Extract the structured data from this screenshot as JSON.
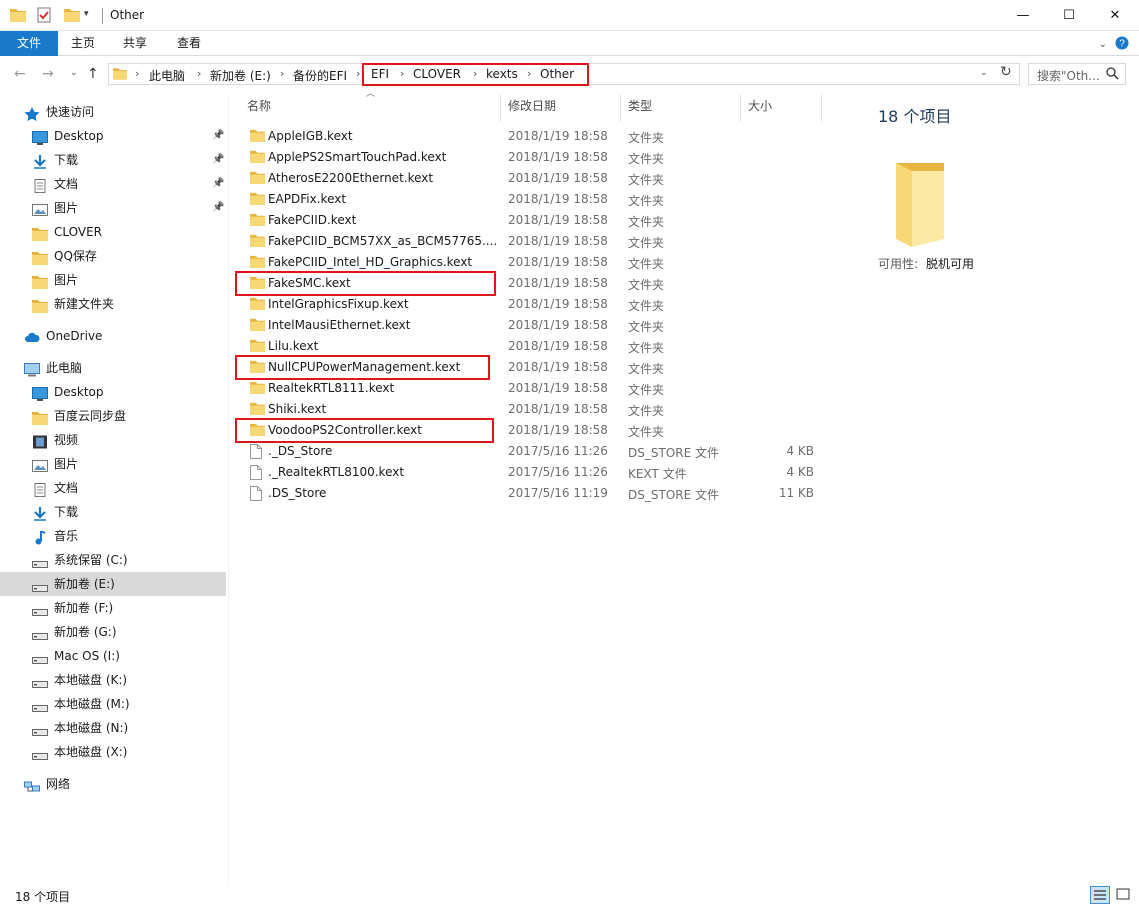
{
  "window": {
    "title": "Other",
    "controls": {
      "minimize": "—",
      "maximize": "☐",
      "close": "✕"
    }
  },
  "ribbon": {
    "tabs": [
      "文件",
      "主页",
      "共享",
      "查看"
    ]
  },
  "address": {
    "crumbs": [
      "此电脑",
      "新加卷 (E:)",
      "备份的EFI",
      "EFI",
      "CLOVER",
      "kexts",
      "Other"
    ],
    "search_placeholder": "搜索\"Oth..."
  },
  "sidebar": {
    "items": [
      {
        "label": "快速访问",
        "icon": "star-icon",
        "level": 0,
        "pinned": false
      },
      {
        "label": "Desktop",
        "icon": "desktop-icon",
        "level": 1,
        "pinned": true
      },
      {
        "label": "下载",
        "icon": "download-icon",
        "level": 1,
        "pinned": true
      },
      {
        "label": "文档",
        "icon": "document-icon",
        "level": 1,
        "pinned": true
      },
      {
        "label": "图片",
        "icon": "picture-icon",
        "level": 1,
        "pinned": true
      },
      {
        "label": "CLOVER",
        "icon": "folder-icon",
        "level": 1,
        "pinned": false
      },
      {
        "label": "QQ保存",
        "icon": "folder-icon",
        "level": 1,
        "pinned": false
      },
      {
        "label": "图片",
        "icon": "folder-icon",
        "level": 1,
        "pinned": false
      },
      {
        "label": "新建文件夹",
        "icon": "folder-icon",
        "level": 1,
        "pinned": false
      },
      {
        "label": "OneDrive",
        "icon": "cloud-icon",
        "level": 0,
        "pinned": false
      },
      {
        "label": "此电脑",
        "icon": "computer-icon",
        "level": 0,
        "pinned": false
      },
      {
        "label": "Desktop",
        "icon": "desktop-icon",
        "level": 1,
        "pinned": false
      },
      {
        "label": "百度云同步盘",
        "icon": "folder-icon",
        "level": 1,
        "pinned": false
      },
      {
        "label": "视频",
        "icon": "video-icon",
        "level": 1,
        "pinned": false
      },
      {
        "label": "图片",
        "icon": "picture-icon",
        "level": 1,
        "pinned": false
      },
      {
        "label": "文档",
        "icon": "document-icon",
        "level": 1,
        "pinned": false
      },
      {
        "label": "下载",
        "icon": "download-icon",
        "level": 1,
        "pinned": false
      },
      {
        "label": "音乐",
        "icon": "music-icon",
        "level": 1,
        "pinned": false
      },
      {
        "label": "系统保留 (C:)",
        "icon": "drive-icon",
        "level": 1,
        "pinned": false
      },
      {
        "label": "新加卷 (E:)",
        "icon": "drive-icon",
        "level": 1,
        "pinned": false,
        "selected": true
      },
      {
        "label": "新加卷 (F:)",
        "icon": "drive-icon",
        "level": 1,
        "pinned": false
      },
      {
        "label": "新加卷 (G:)",
        "icon": "drive-icon",
        "level": 1,
        "pinned": false
      },
      {
        "label": "Mac OS (I:)",
        "icon": "drive-icon",
        "level": 1,
        "pinned": false
      },
      {
        "label": "本地磁盘 (K:)",
        "icon": "drive-icon",
        "level": 1,
        "pinned": false
      },
      {
        "label": "本地磁盘 (M:)",
        "icon": "drive-icon",
        "level": 1,
        "pinned": false
      },
      {
        "label": "本地磁盘 (N:)",
        "icon": "drive-icon",
        "level": 1,
        "pinned": false
      },
      {
        "label": "本地磁盘 (X:)",
        "icon": "drive-icon",
        "level": 1,
        "pinned": false
      },
      {
        "label": "网络",
        "icon": "network-icon",
        "level": 0,
        "pinned": false
      }
    ]
  },
  "columns": {
    "name": "名称",
    "date": "修改日期",
    "type": "类型",
    "size": "大小"
  },
  "files": [
    {
      "name": "AppleIGB.kext",
      "date": "2018/1/19 18:58",
      "type": "文件夹",
      "size": "",
      "kind": "folder",
      "highlighted": false
    },
    {
      "name": "ApplePS2SmartTouchPad.kext",
      "date": "2018/1/19 18:58",
      "type": "文件夹",
      "size": "",
      "kind": "folder",
      "highlighted": false
    },
    {
      "name": "AtherosE2200Ethernet.kext",
      "date": "2018/1/19 18:58",
      "type": "文件夹",
      "size": "",
      "kind": "folder",
      "highlighted": false
    },
    {
      "name": "EAPDFix.kext",
      "date": "2018/1/19 18:58",
      "type": "文件夹",
      "size": "",
      "kind": "folder",
      "highlighted": false
    },
    {
      "name": "FakePCIID.kext",
      "date": "2018/1/19 18:58",
      "type": "文件夹",
      "size": "",
      "kind": "folder",
      "highlighted": false
    },
    {
      "name": "FakePCIID_BCM57XX_as_BCM57765....",
      "date": "2018/1/19 18:58",
      "type": "文件夹",
      "size": "",
      "kind": "folder",
      "highlighted": false
    },
    {
      "name": "FakePCIID_Intel_HD_Graphics.kext",
      "date": "2018/1/19 18:58",
      "type": "文件夹",
      "size": "",
      "kind": "folder",
      "highlighted": false
    },
    {
      "name": "FakeSMC.kext",
      "date": "2018/1/19 18:58",
      "type": "文件夹",
      "size": "",
      "kind": "folder",
      "highlighted": true
    },
    {
      "name": "IntelGraphicsFixup.kext",
      "date": "2018/1/19 18:58",
      "type": "文件夹",
      "size": "",
      "kind": "folder",
      "highlighted": false
    },
    {
      "name": "IntelMausiEthernet.kext",
      "date": "2018/1/19 18:58",
      "type": "文件夹",
      "size": "",
      "kind": "folder",
      "highlighted": false
    },
    {
      "name": "Lilu.kext",
      "date": "2018/1/19 18:58",
      "type": "文件夹",
      "size": "",
      "kind": "folder",
      "highlighted": false
    },
    {
      "name": "NullCPUPowerManagement.kext",
      "date": "2018/1/19 18:58",
      "type": "文件夹",
      "size": "",
      "kind": "folder",
      "highlighted": true
    },
    {
      "name": "RealtekRTL8111.kext",
      "date": "2018/1/19 18:58",
      "type": "文件夹",
      "size": "",
      "kind": "folder",
      "highlighted": false
    },
    {
      "name": "Shiki.kext",
      "date": "2018/1/19 18:58",
      "type": "文件夹",
      "size": "",
      "kind": "folder",
      "highlighted": false
    },
    {
      "name": "VoodooPS2Controller.kext",
      "date": "2018/1/19 18:58",
      "type": "文件夹",
      "size": "",
      "kind": "folder",
      "highlighted": true
    },
    {
      "name": "._DS_Store",
      "date": "2017/5/16 11:26",
      "type": "DS_STORE 文件",
      "size": "4 KB",
      "kind": "file",
      "highlighted": false
    },
    {
      "name": "._RealtekRTL8100.kext",
      "date": "2017/5/16 11:26",
      "type": "KEXT 文件",
      "size": "4 KB",
      "kind": "file",
      "highlighted": false
    },
    {
      "name": ".DS_Store",
      "date": "2017/5/16 11:19",
      "type": "DS_STORE 文件",
      "size": "11 KB",
      "kind": "file",
      "highlighted": false
    }
  ],
  "preview": {
    "count": "18 个项目",
    "availability_label": "可用性:",
    "availability_value": "脱机可用"
  },
  "status": {
    "count": "18 个项目"
  },
  "colors": {
    "accent": "#1979ca",
    "highlight": "#e0151d",
    "folder": "#f8d775",
    "selected": "#d9d9d9"
  }
}
